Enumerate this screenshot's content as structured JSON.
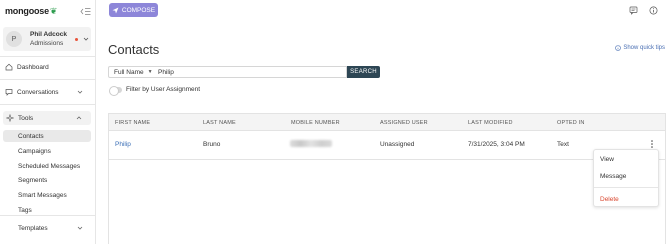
{
  "app": {
    "logo_text": "mongoose"
  },
  "user": {
    "initial": "P",
    "name": "Phil Adcock",
    "subtitle": "Admissions"
  },
  "nav": {
    "dashboard": "Dashboard",
    "conversations": "Conversations",
    "tools": "Tools",
    "templates": "Templates",
    "tools_items": [
      "Contacts",
      "Campaigns",
      "Scheduled Messages",
      "Segments",
      "Smart Messages",
      "Tags"
    ]
  },
  "topbar": {
    "compose_label": "COMPOSE"
  },
  "page": {
    "title": "Contacts",
    "quick_tips": "Show quick tips"
  },
  "search": {
    "field_selected": "Full Name",
    "query": "Philip",
    "button_label": "SEARCH"
  },
  "filter": {
    "label": "Filter by User Assignment"
  },
  "table": {
    "headers": [
      "FIRST NAME",
      "LAST NAME",
      "MOBILE NUMBER",
      "ASSIGNED USER",
      "LAST MODIFIED",
      "OPTED IN"
    ],
    "rows": [
      {
        "first_name": "Philip",
        "last_name": "Bruno",
        "assigned_user": "Unassigned",
        "last_modified": "7/31/2025, 3:04 PM",
        "opted_in": "Text"
      }
    ]
  },
  "row_menu": {
    "view": "View",
    "message": "Message",
    "delete": "Delete"
  },
  "colors": {
    "accent": "#8d86d9",
    "search_button": "#2d4654",
    "link": "#3b6fb6",
    "danger": "#d9472f",
    "status_dot": "#e8533a"
  }
}
